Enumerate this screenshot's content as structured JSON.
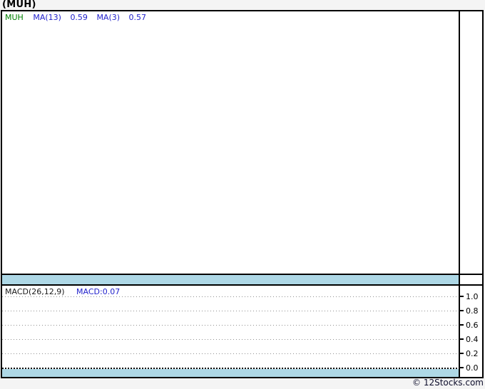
{
  "header": {
    "title": "(MUH)"
  },
  "main_panel": {
    "legend": {
      "symbol": "MUH",
      "ma13_label": "MA(13)",
      "ma13_value": "0.59",
      "ma3_label": "MA(3)",
      "ma3_value": "0.57"
    }
  },
  "macd_panel": {
    "legend": {
      "label": "MACD(26,12,9)",
      "value": "MACD:0.07"
    },
    "axis": {
      "ticks": [
        "1.0",
        "0.8",
        "0.6",
        "0.4",
        "0.2",
        "0.0"
      ]
    }
  },
  "footer": {
    "watermark": "© 12Stocks.com"
  },
  "colors": {
    "band_blue": "#aed8e6",
    "symbol_green": "#008000",
    "value_blue": "#2222cc",
    "background_gray": "#f4f4f4",
    "border_black": "#000000",
    "gridline_gray": "#909090"
  },
  "chart_data": [
    {
      "type": "line",
      "title": "(MUH) price with moving averages",
      "series": [
        {
          "name": "MUH",
          "values": []
        },
        {
          "name": "MA(13)",
          "last_value": 0.59,
          "values": []
        },
        {
          "name": "MA(3)",
          "last_value": 0.57,
          "values": []
        }
      ],
      "xlabel": "",
      "ylabel": "",
      "grid": "off",
      "note": "plot area is empty — no visible price data or axis labels"
    },
    {
      "type": "line",
      "title": "MACD(26,12,9)",
      "series": [
        {
          "name": "MACD",
          "last_value": 0.07,
          "values": []
        }
      ],
      "xlabel": "",
      "ylabel": "",
      "ylim": [
        0.0,
        1.0
      ],
      "yticks": [
        1.0,
        0.8,
        0.6,
        0.4,
        0.2,
        0.0
      ],
      "grid": "horizontal dotted",
      "note": "plot area is empty — no visible MACD line"
    }
  ]
}
